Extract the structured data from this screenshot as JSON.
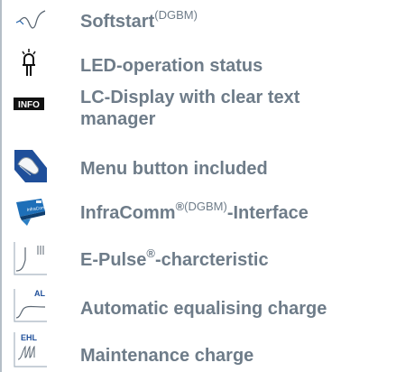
{
  "features": [
    {
      "icon": "softstart-curve-icon",
      "text": "Softstart",
      "sup": "(DGBM)"
    },
    {
      "icon": "led-icon",
      "text": "LED-operation status"
    },
    {
      "icon": "info-icon",
      "icon_label": "INFO",
      "text_line1": "LC-Display with clear text",
      "text_line2": "manager"
    },
    {
      "icon": "menu-button-press-icon",
      "text": "Menu button included"
    },
    {
      "icon": "infracomm-device-icon",
      "icon_label": "InfraComm",
      "text": "InfraComm",
      "sup_reg": "®",
      "sup": "(DGBM)",
      "tail": "-Interface"
    },
    {
      "icon": "e-pulse-curve-icon",
      "text": "E-Pulse",
      "sup_reg": "®",
      "tail": "-charcteristic"
    },
    {
      "icon": "equalising-charge-curve-icon",
      "icon_label": "AL",
      "text": "Automatic equalising charge"
    },
    {
      "icon": "maintenance-charge-curve-icon",
      "icon_label": "EHL",
      "text": "Maintenance charge"
    }
  ],
  "colors": {
    "text": "#6e7c89",
    "icon_blue": "#1f5fa8",
    "icon_frame": "#a8b4c0"
  }
}
